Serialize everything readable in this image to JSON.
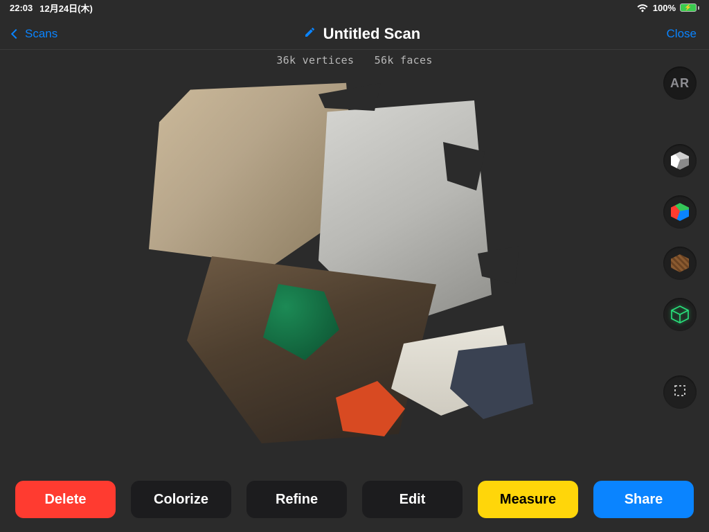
{
  "status": {
    "time": "22:03",
    "date": "12月24日(木)",
    "battery_pct": "100%"
  },
  "nav": {
    "back_label": "Scans",
    "title": "Untitled Scan",
    "close_label": "Close"
  },
  "stats": {
    "vertices": "36k vertices",
    "faces": "56k faces"
  },
  "side_tools": {
    "ar_label": "AR"
  },
  "bottom": {
    "delete": "Delete",
    "colorize": "Colorize",
    "refine": "Refine",
    "edit": "Edit",
    "measure": "Measure",
    "share": "Share"
  }
}
